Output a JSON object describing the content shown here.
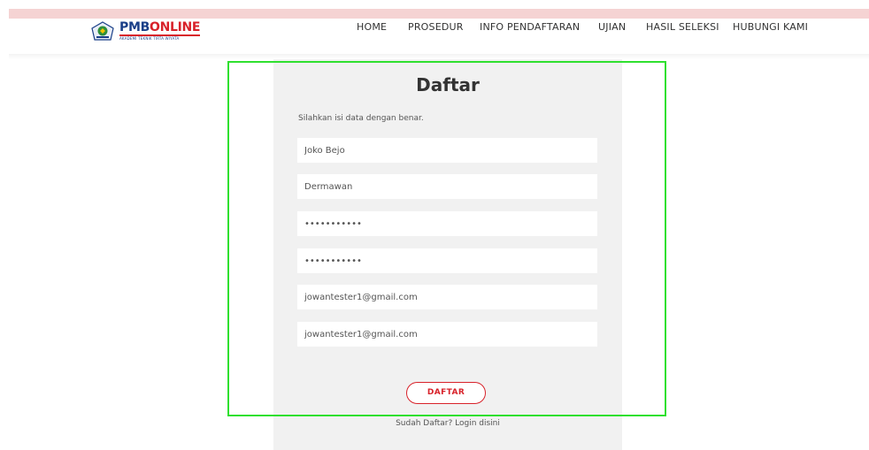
{
  "header": {
    "logo": {
      "brand_part1": "PMB",
      "brand_part2": "ONLINE",
      "subtitle": "AKADEMI TEKNIK TIRTA WIYATA",
      "icon": "institution-badge-icon",
      "colors": {
        "primary": "#1a3f88",
        "accent": "#d8222a"
      }
    },
    "nav": [
      {
        "label": "HOME"
      },
      {
        "label": "PROSEDUR"
      },
      {
        "label": "INFO PENDAFTARAN"
      },
      {
        "label": "UJIAN"
      },
      {
        "label": "HASIL SELEKSI"
      },
      {
        "label": "HUBUNGI KAMI"
      }
    ]
  },
  "form": {
    "title": "Daftar",
    "instruction": "Silahkan isi data dengan benar.",
    "fields": [
      {
        "name": "first-name",
        "value": "Joko Bejo",
        "type": "text"
      },
      {
        "name": "last-name",
        "value": "Dermawan",
        "type": "text"
      },
      {
        "name": "password",
        "value": "•••••••••••",
        "type": "password"
      },
      {
        "name": "password-confirm",
        "value": "•••••••••••",
        "type": "password"
      },
      {
        "name": "email",
        "value": "jowantester1@gmail.com",
        "type": "email"
      },
      {
        "name": "email-confirm",
        "value": "jowantester1@gmail.com",
        "type": "email"
      }
    ],
    "submit_label": "DAFTAR",
    "login_prompt": "Sudah Daftar? Login disini"
  },
  "colors": {
    "top_bar": "#f5d3d3",
    "panel": "#f1f1f1",
    "highlight": "#2fe02f",
    "button_accent": "#d8222a"
  }
}
